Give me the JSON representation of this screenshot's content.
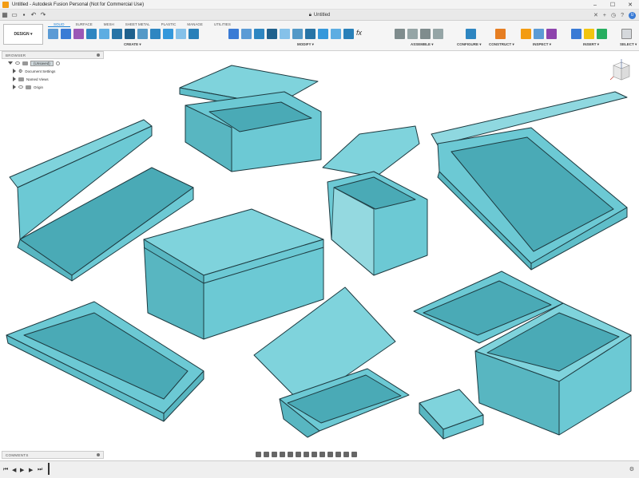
{
  "window": {
    "title": "Untitled - Autodesk Fusion Personal (Not for Commercial Use)",
    "doc_tab": "Untitled",
    "buttons": [
      "–",
      "☐",
      "✕"
    ]
  },
  "ribbon": {
    "workspace": "DESIGN ▾",
    "tabs": [
      "SOLID",
      "SURFACE",
      "MESH",
      "SHEET METAL",
      "PLASTIC",
      "MANAGE",
      "UTILITIES"
    ],
    "active_tab": "SOLID",
    "groups": [
      "CREATE ▾",
      "MODIFY ▾",
      "ASSEMBLE ▾",
      "CONFIGURE ▾",
      "CONSTRUCT ▾",
      "INSPECT ▾",
      "INSERT ▾",
      "SELECT ▾"
    ]
  },
  "browser": {
    "title": "BROWSER",
    "root": "(Unsaved)",
    "items": [
      "Document Settings",
      "Named Views",
      "Origin"
    ]
  },
  "comments": {
    "title": "COMMENTS"
  },
  "colors": {
    "accent": "#1a7fd4",
    "model": "#6cc9d4",
    "model_dark": "#4aaab6",
    "edge": "#1d3a40"
  }
}
